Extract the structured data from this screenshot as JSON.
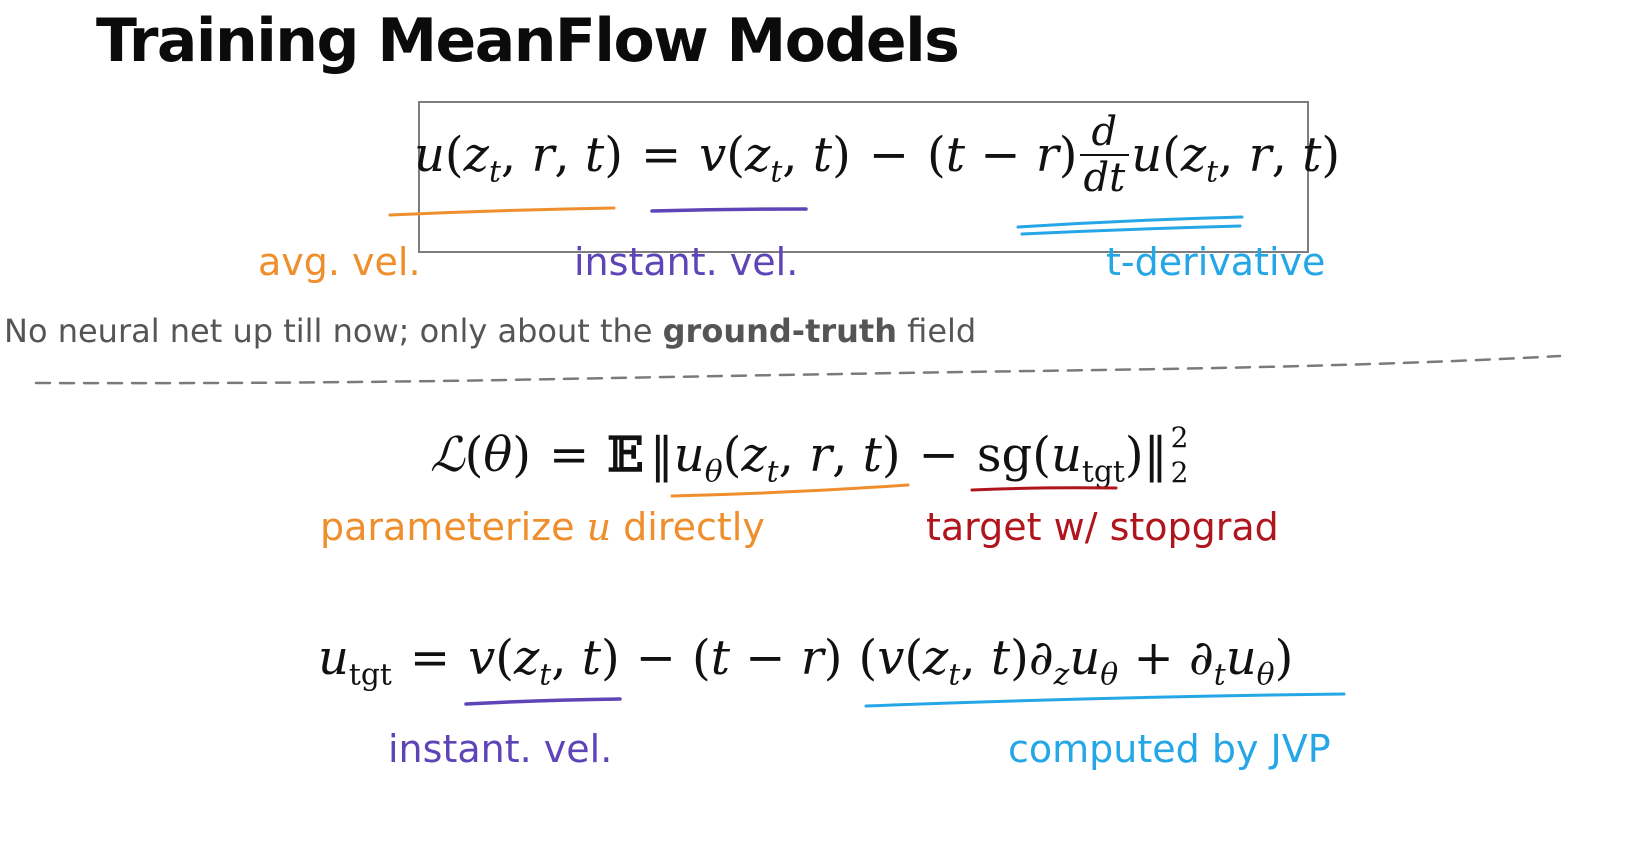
{
  "slide": {
    "title": "Training MeanFlow Models"
  },
  "labels": {
    "avg_vel": "avg. vel.",
    "instant_vel_top": "instant. vel.",
    "t_derivative": "t-derivative",
    "parameterize_pre": "parameterize ",
    "parameterize_var": "u",
    "parameterize_post": " directly",
    "target_stopgrad": "target w/ stopgrad",
    "instant_vel_bottom": "instant. vel.",
    "computed_by_jvp": "computed by JVP"
  },
  "note": {
    "pre": "No neural net up till now; only about the ",
    "bold": "ground-truth",
    "post": " field"
  },
  "colors": {
    "orange": "#ef8e2c",
    "purple": "#5e45b7",
    "blue": "#25a6e6",
    "red": "#b0141d",
    "gray": "#555555"
  }
}
